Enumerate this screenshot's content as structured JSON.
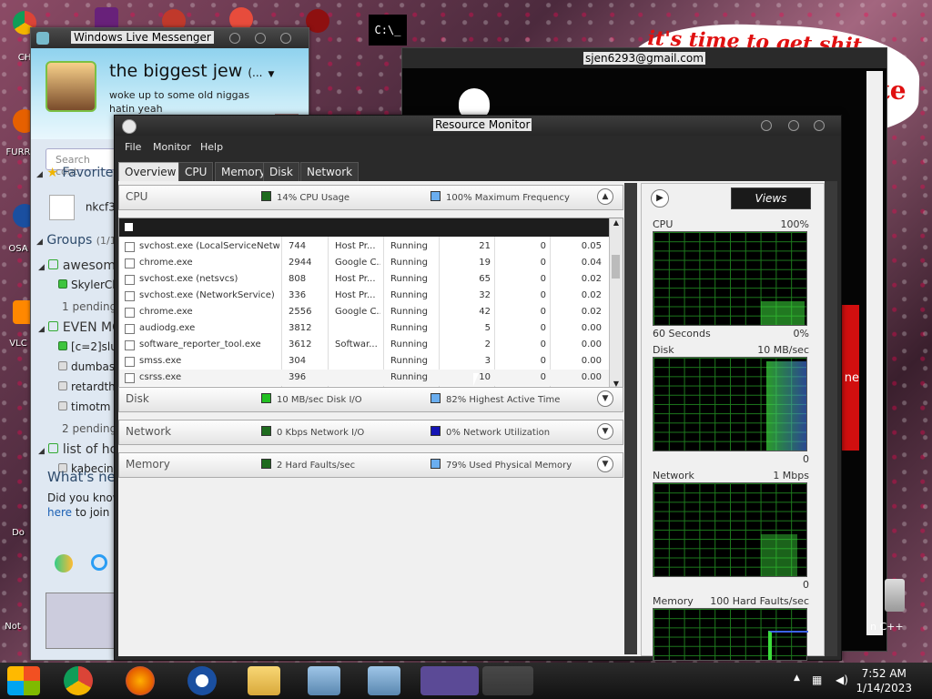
{
  "desktop": {
    "banner_text": "it's time to get shit",
    "banner_fragment": "te",
    "icon_labels": [
      "CH",
      "FURR",
      "OSA",
      "VLC",
      "Do",
      "Not"
    ],
    "red_button_fragment": "ne",
    "right_label": "n C++"
  },
  "background_window": {
    "title": "sjen6293@gmail.com",
    "icon_text": "C:\\_"
  },
  "messenger": {
    "title": "Windows Live Messenger",
    "display_name": "the biggest jew",
    "display_name_suffix": "(...",
    "status_message": "woke up to some old niggas hatin yeah",
    "search_placeholder": "Search cont",
    "favorites_label": "Favorite",
    "favorite_contact": "nkcf3",
    "groups_label": "Groups",
    "groups_count": "(1/1",
    "rows": [
      {
        "type": "group",
        "text": "awesome"
      },
      {
        "type": "online",
        "text": "SkylerCl"
      },
      {
        "type": "pending",
        "text": "1 pending"
      },
      {
        "type": "group",
        "text": "EVEN MC"
      },
      {
        "type": "online",
        "text": "[c=2]slur"
      },
      {
        "type": "offline",
        "text": "dumbass"
      },
      {
        "type": "offline",
        "text": "retardth"
      },
      {
        "type": "offline",
        "text": "timotm"
      },
      {
        "type": "pending",
        "text": "2 pending"
      },
      {
        "type": "group",
        "text": "list of ho"
      },
      {
        "type": "offline",
        "text": "kabecinh"
      }
    ],
    "whats_new": "What's ne",
    "did_you_know": "Did you know",
    "did_you_link": "here",
    "did_you_rest": "to join"
  },
  "resource_monitor": {
    "title": "Resource Monitor",
    "menu": [
      "File",
      "Monitor",
      "Help"
    ],
    "tabs": [
      "Overview",
      "CPU",
      "Memory",
      "Disk",
      "Network"
    ],
    "active_tab": "Overview",
    "cpu": {
      "label": "CPU",
      "metric1": "14% CPU Usage",
      "metric2": "100% Maximum Frequency",
      "color1": "#1e6b1e",
      "color2": "#6aaef0",
      "processes": [
        [
          "svchost.exe (LocalServiceNetw...",
          "744",
          "Host Pr...",
          "Running",
          "21",
          "0",
          "0.05"
        ],
        [
          "chrome.exe",
          "2944",
          "Google C...",
          "Running",
          "19",
          "0",
          "0.04"
        ],
        [
          "svchost.exe (netsvcs)",
          "808",
          "Host Pr...",
          "Running",
          "65",
          "0",
          "0.02"
        ],
        [
          "svchost.exe (NetworkService)",
          "336",
          "Host Pr...",
          "Running",
          "32",
          "0",
          "0.02"
        ],
        [
          "chrome.exe",
          "2556",
          "Google C...",
          "Running",
          "42",
          "0",
          "0.02"
        ],
        [
          "audiodg.exe",
          "3812",
          "",
          "Running",
          "5",
          "0",
          "0.00"
        ],
        [
          "software_reporter_tool.exe",
          "3612",
          "Softwar...",
          "Running",
          "2",
          "0",
          "0.00"
        ],
        [
          "smss.exe",
          "304",
          "",
          "Running",
          "3",
          "0",
          "0.00"
        ],
        [
          "csrss.exe",
          "396",
          "",
          "Running",
          "10",
          "0",
          "0.00"
        ]
      ]
    },
    "disk": {
      "label": "Disk",
      "metric1": "10 MB/sec Disk I/O",
      "metric2": "82% Highest Active Time",
      "color1": "#22c022",
      "color2": "#6aaef0"
    },
    "network": {
      "label": "Network",
      "metric1": "0 Kbps Network I/O",
      "metric2": "0% Network Utilization",
      "color1": "#1e6b1e",
      "color2": "#1414b4"
    },
    "memory": {
      "label": "Memory",
      "metric1": "2 Hard Faults/sec",
      "metric2": "79% Used Physical Memory",
      "color1": "#1e6b1e",
      "color2": "#6aaef0"
    },
    "views_label": "Views",
    "graphs": [
      {
        "label": "CPU",
        "value": "100%",
        "footer_left": "60 Seconds",
        "footer_right": "0%"
      },
      {
        "label": "Disk",
        "value": "10 MB/sec",
        "footer_left": "",
        "footer_right": "0"
      },
      {
        "label": "Network",
        "value": "1 Mbps",
        "footer_left": "",
        "footer_right": "0"
      },
      {
        "label": "Memory",
        "value": "100 Hard Faults/sec",
        "footer_left": "",
        "footer_right": ""
      }
    ]
  },
  "taskbar": {
    "time": "7:52 AM",
    "date": "1/14/2023",
    "items": [
      "start-orb",
      "chrome",
      "firefox",
      "opera",
      "explorer",
      "installer",
      "installer2",
      "messenger",
      "resource-monitor"
    ]
  }
}
